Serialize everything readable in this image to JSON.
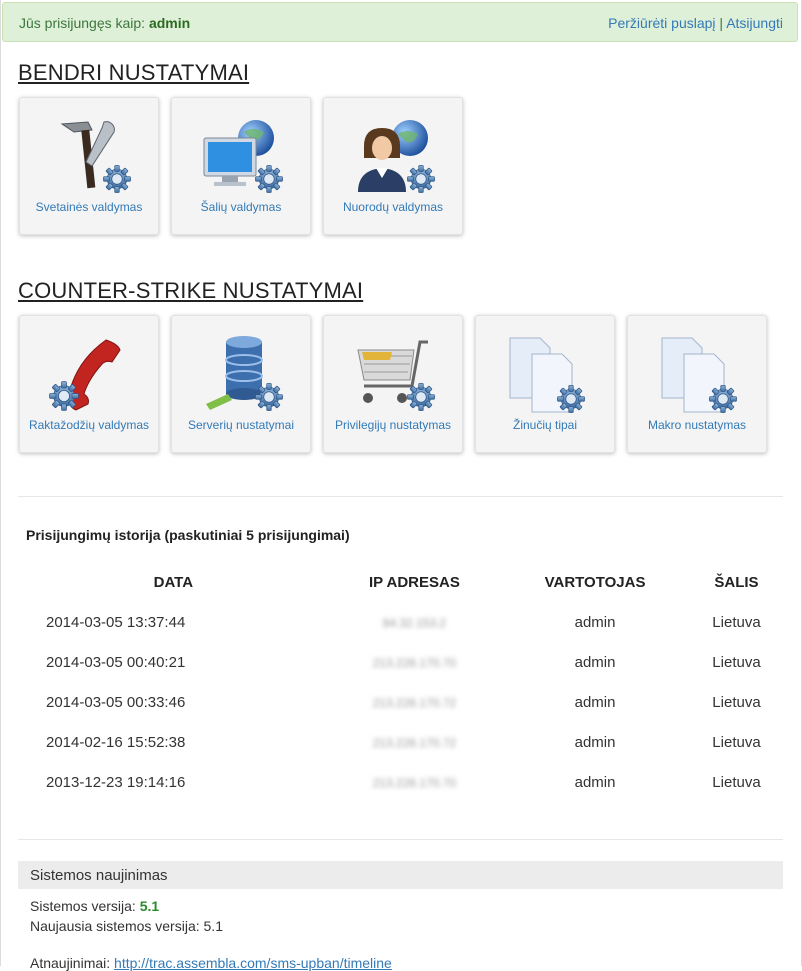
{
  "topbar": {
    "logged_in_prefix": "Jūs prisijungęs kaip:",
    "username": "admin",
    "view_page": "Peržiūrėti puslapį",
    "separator": "|",
    "logout": "Atsijungti"
  },
  "general": {
    "title": "BENDRI NUSTATYMAI",
    "tiles": [
      {
        "label": "Svetainės valdymas",
        "icon": "tools-gear-icon"
      },
      {
        "label": "Šalių valdymas",
        "icon": "monitor-globe-gear-icon"
      },
      {
        "label": "Nuorodų valdymas",
        "icon": "person-globe-gear-icon"
      }
    ]
  },
  "cs": {
    "title": "COUNTER-STRIKE NUSTATYMAI",
    "tiles": [
      {
        "label": "Raktažodžių valdymas",
        "icon": "phone-gear-icon"
      },
      {
        "label": "Serverių nustatymai",
        "icon": "database-gear-icon"
      },
      {
        "label": "Privilegijų nustatymas",
        "icon": "cart-gear-icon"
      },
      {
        "label": "Žinučių tipai",
        "icon": "documents-gear-icon"
      },
      {
        "label": "Makro nustatymas",
        "icon": "documents-gear-icon"
      }
    ]
  },
  "history": {
    "title": "Prisijungimų istorija (paskutiniai 5 prisijungimai)",
    "columns": [
      "DATA",
      "IP ADRESAS",
      "VARTOTOJAS",
      "ŠALIS"
    ],
    "rows": [
      {
        "date": "2014-03-05 13:37:44",
        "ip": "84.32.153.2",
        "user": "admin",
        "country": "Lietuva"
      },
      {
        "date": "2014-03-05 00:40:21",
        "ip": "213.226.170.70",
        "user": "admin",
        "country": "Lietuva"
      },
      {
        "date": "2014-03-05 00:33:46",
        "ip": "213.226.170.72",
        "user": "admin",
        "country": "Lietuva"
      },
      {
        "date": "2014-02-16 15:52:38",
        "ip": "213.226.170.72",
        "user": "admin",
        "country": "Lietuva"
      },
      {
        "date": "2013-12-23 19:14:16",
        "ip": "213.226.170.70",
        "user": "admin",
        "country": "Lietuva"
      }
    ]
  },
  "update": {
    "title": "Sistemos naujinimas",
    "version_label": "Sistemos versija:",
    "version": "5.1",
    "latest_label": "Naujausia sistemos versija:",
    "latest": "5.1",
    "updates_label": "Atnaujinimai:",
    "updates_link": "http://trac.assembla.com/sms-upban/timeline"
  }
}
